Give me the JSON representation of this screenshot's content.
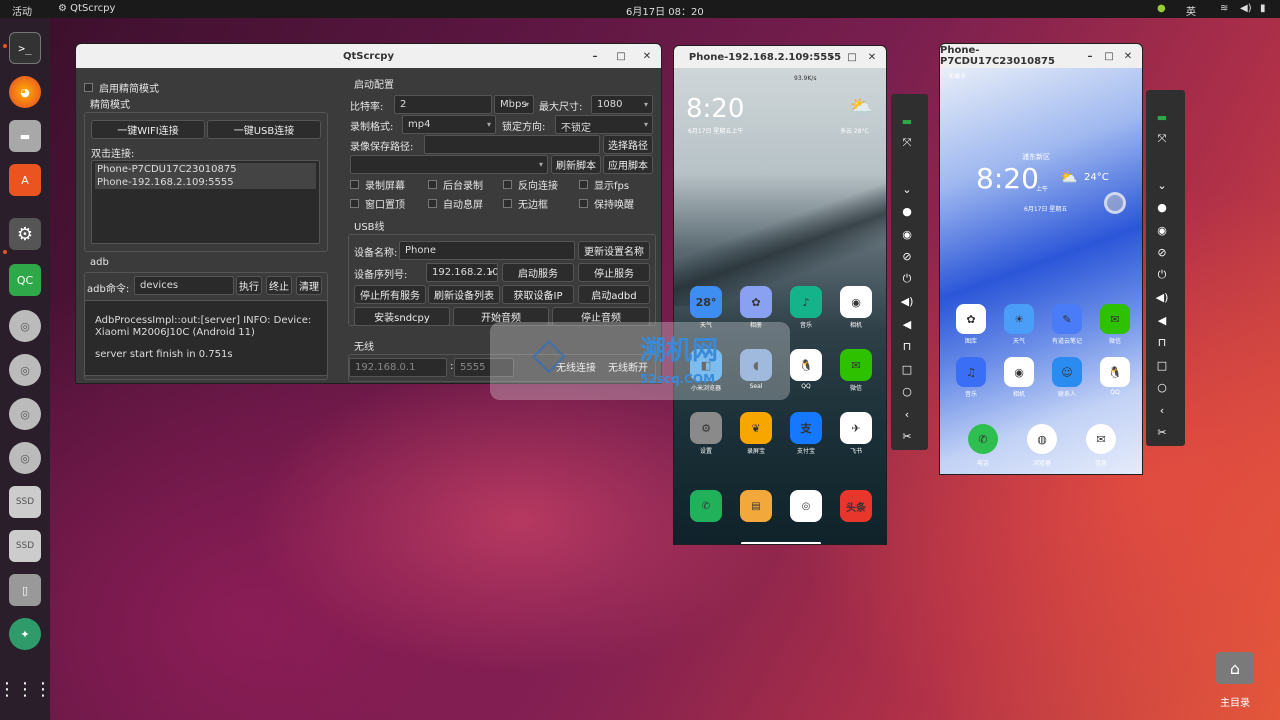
{
  "topbar": {
    "activities": "活动",
    "app": "QtScrcpy",
    "clock": "6月17日  08：20",
    "ime": "英"
  },
  "main": {
    "title": "QtScrcpy",
    "simple_mode_check": "启用精简模式",
    "simple_group": "精简模式",
    "wifi_btn": "一键WIFI连接",
    "usb_btn": "一键USB连接",
    "double_click": "双击连接:",
    "devices": [
      "Phone-P7CDU17C23010875",
      "Phone-192.168.2.109:5555"
    ],
    "adb_group": "adb",
    "adb_label": "adb命令:",
    "adb_cmd": "devices",
    "exec_btn": "执行",
    "stop_btn": "终止",
    "clear_btn": "清理",
    "log": [
      "AdbProcessImpl::out:[server] INFO: Device: Xiaomi M2006J10C (Android 11)",
      "server start finish in 0.751s"
    ],
    "start_cfg": "启动配置",
    "bitrate_label": "比特率:",
    "bitrate": "2",
    "bitrate_unit": "Mbps",
    "maxsize_label": "最大尺寸:",
    "maxsize": "1080",
    "rec_fmt_label": "录制格式:",
    "rec_fmt": "mp4",
    "lock_label": "锁定方向:",
    "lock": "不锁定",
    "save_path_label": "录像保存路径:",
    "select_path_btn": "选择路径",
    "refresh_script_btn": "刷新脚本",
    "apply_script_btn": "应用脚本",
    "checks": [
      "录制屏幕",
      "后台录制",
      "反向连接",
      "显示fps",
      "窗口置顶",
      "自动息屏",
      "无边框",
      "保持唤醒"
    ],
    "usb_group": "USB线",
    "dev_name_label": "设备名称:",
    "dev_name": "Phone",
    "update_name_btn": "更新设置名称",
    "serial_label": "设备序列号:",
    "serial": "192.168.2.10",
    "start_service_btn": "启动服务",
    "stop_service_btn": "停止服务",
    "stop_all_btn": "停止所有服务",
    "refresh_dev_btn": "刷新设备列表",
    "get_ip_btn": "获取设备IP",
    "start_adbd_btn": "启动adbd",
    "install_sndcpy_btn": "安装sndcpy",
    "start_audio_btn": "开始音频",
    "stop_audio_btn": "停止音频",
    "wireless_group": "无线",
    "ip_placeholder": "192.168.0.1",
    "port_placeholder": "5555",
    "wireless_connect_btn": "无线连接",
    "wireless_disconnect_btn": "无线断开"
  },
  "phone1": {
    "title": "Phone-192.168.2.109:5555",
    "time": "8:20",
    "date": "6月17日 星期五上午",
    "weather": "多云 28°C",
    "status": "93.9K/s",
    "apps": [
      {
        "name": "天气",
        "glyph": "28°",
        "color": "#3d8ef0"
      },
      {
        "name": "相册",
        "glyph": "✿",
        "color": "#8aa0f0"
      },
      {
        "name": "音乐",
        "glyph": "♪",
        "color": "#15b38a"
      },
      {
        "name": "相机",
        "glyph": "◉",
        "color": "#ffffff"
      },
      {
        "name": "小米浏览器",
        "glyph": "◧",
        "color": "#4aa3e8"
      },
      {
        "name": "Seal",
        "glyph": "◖",
        "color": "#7aa0d0"
      },
      {
        "name": "QQ",
        "glyph": "🐧",
        "color": "#ffffff"
      },
      {
        "name": "微信",
        "glyph": "✉",
        "color": "#2dc100"
      },
      {
        "name": "设置",
        "glyph": "⚙",
        "color": "#8a8a8a"
      },
      {
        "name": "录屏宝",
        "glyph": "❦",
        "color": "#f7a600"
      },
      {
        "name": "支付宝",
        "glyph": "支",
        "color": "#1677ff"
      },
      {
        "name": "飞书",
        "glyph": "✈",
        "color": "#ffffff"
      }
    ],
    "dock": [
      {
        "glyph": "✆",
        "color": "#20b15a"
      },
      {
        "glyph": "▤",
        "color": "#f3a83b"
      },
      {
        "glyph": "◎",
        "color": "#ffffff"
      },
      {
        "glyph": "头条",
        "color": "#e8362c"
      }
    ]
  },
  "phone2": {
    "title": "Phone-P7CDU17C23010875",
    "carrier": "未插卡",
    "time": "8:20",
    "ampm": "上午",
    "location": "浦东新区",
    "date": "6月17日 星期五",
    "temp": "24°C",
    "apps": [
      {
        "name": "图库",
        "glyph": "✿",
        "color": "#ffffff"
      },
      {
        "name": "天气",
        "glyph": "☀",
        "color": "#4a9ef7"
      },
      {
        "name": "有道云笔记",
        "glyph": "✎",
        "color": "#4a7cf7"
      },
      {
        "name": "微信",
        "glyph": "✉",
        "color": "#2dc100"
      },
      {
        "name": "音乐",
        "glyph": "♫",
        "color": "#3a6ef5"
      },
      {
        "name": "相机",
        "glyph": "◉",
        "color": "#ffffff"
      },
      {
        "name": "联系人",
        "glyph": "☺",
        "color": "#2a8cf0"
      },
      {
        "name": "QQ",
        "glyph": "🐧",
        "color": "#ffffff"
      }
    ],
    "dock": [
      {
        "name": "电话",
        "glyph": "✆",
        "color": "#2fbf50"
      },
      {
        "name": "浏览器",
        "glyph": "◍",
        "color": "#ffffff"
      },
      {
        "name": "信息",
        "glyph": "✉",
        "color": "#ffffff"
      }
    ]
  },
  "side_controls": [
    "switch-icon",
    "fullscreen-icon",
    "collapse-icon",
    "dot-icon",
    "eye-icon",
    "eye-off-icon",
    "power-icon",
    "volume-up-icon",
    "volume-down-icon",
    "app-switch-icon",
    "home-icon",
    "recent-icon",
    "back-icon",
    "screenshot-icon"
  ],
  "watermark": {
    "text": "溯机网",
    "sub": "52scq.COM"
  },
  "desktop": {
    "home_label": "主目录"
  }
}
